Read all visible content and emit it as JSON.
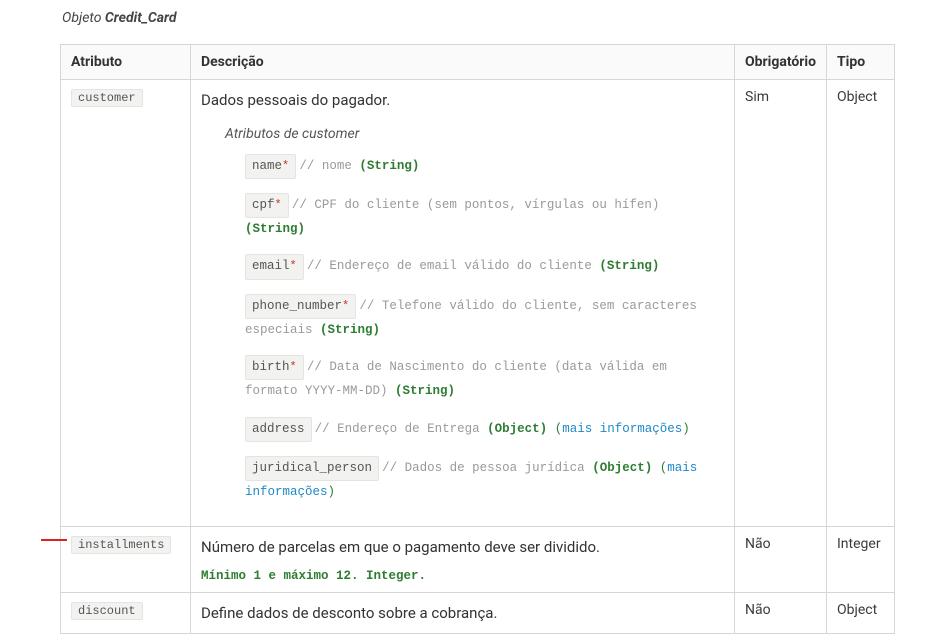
{
  "title_prefix": "Objeto ",
  "title_object": "Credit_Card",
  "headers": {
    "attribute": "Atributo",
    "description": "Descrição",
    "required": "Obrigatório",
    "type": "Tipo"
  },
  "rows": {
    "customer": {
      "attr": "customer",
      "desc": "Dados pessoais do pagador.",
      "required": "Sim",
      "type": "Object",
      "subtitle": "Atributos de customer",
      "subs": {
        "name": {
          "label": "name",
          "star": "*",
          "sep": " // ",
          "comment": "nome ",
          "typ": "(String)"
        },
        "cpf": {
          "label": "cpf",
          "star": "*",
          "sep": " // ",
          "comment": "CPF do cliente (sem pontos, vírgulas ou hífen) ",
          "typ": "(String)"
        },
        "email": {
          "label": "email",
          "star": "*",
          "sep": " // ",
          "comment": "Endereço de email válido do cliente ",
          "typ": "(String)"
        },
        "phone_number": {
          "label": "phone_number",
          "star": "*",
          "sep": " // ",
          "comment": "Telefone válido do cliente, sem caracteres especiais ",
          "typ": "(String)"
        },
        "birth": {
          "label": "birth",
          "star": "*",
          "sep": " // ",
          "comment": "Data de Nascimento do cliente (data válida em formato YYYY-MM-DD) ",
          "typ": "(String)"
        },
        "address": {
          "label": "address",
          "star": "",
          "sep": " // ",
          "comment": "Endereço de Entrega ",
          "typ": "(Object)",
          "link_open": " (",
          "link": "mais informações",
          "link_close": ")"
        },
        "juridical_person": {
          "label": "juridical_person",
          "star": "",
          "sep": " // ",
          "comment": "Dados de pessoa jurídica ",
          "typ": "(Object)",
          "link_open": " (",
          "link": "mais informações",
          "link_close": ")"
        }
      }
    },
    "installments": {
      "attr": "installments",
      "desc": "Número de parcelas em que o pagamento deve ser dividido.",
      "note": "Mínimo 1 e máximo 12. Integer.",
      "required": "Não",
      "type": "Integer"
    },
    "discount": {
      "attr": "discount",
      "desc": "Define dados de desconto sobre a cobrança.",
      "required": "Não",
      "type": "Object"
    }
  }
}
